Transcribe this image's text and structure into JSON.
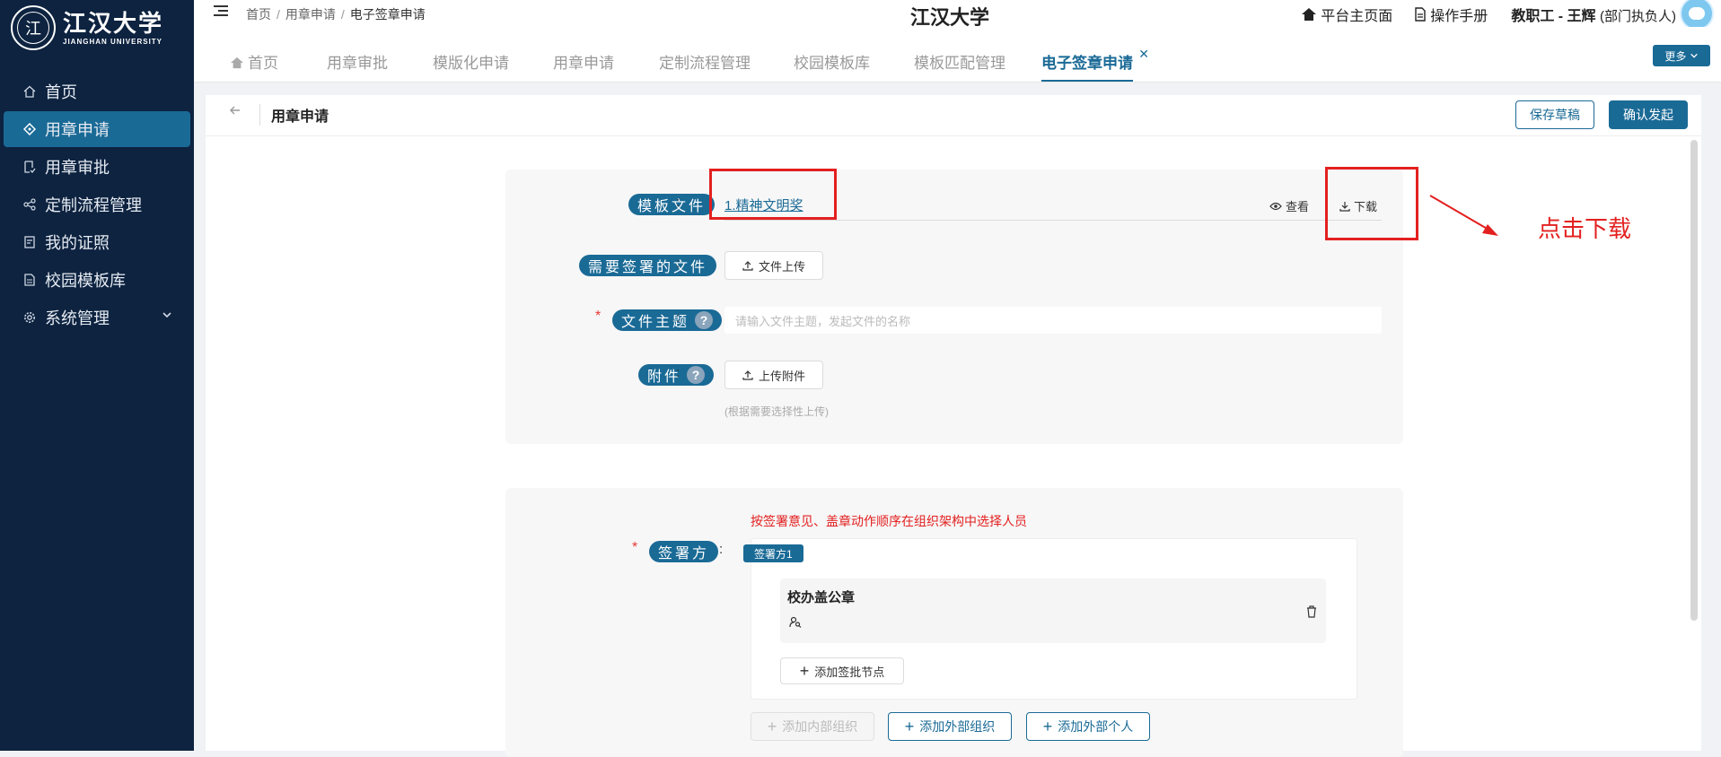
{
  "logo": {
    "seal_char": "江",
    "name_cn": "江汉大学",
    "name_en": "JIANGHAN UNIVERSITY"
  },
  "sidebar": {
    "items": [
      {
        "label": "首页",
        "icon": "home-icon"
      },
      {
        "label": "用章申请",
        "icon": "diamond-icon",
        "active": true
      },
      {
        "label": "用章审批",
        "icon": "document-check-icon"
      },
      {
        "label": "定制流程管理",
        "icon": "share-nodes-icon"
      },
      {
        "label": "我的证照",
        "icon": "certificate-icon"
      },
      {
        "label": "校园模板库",
        "icon": "file-template-icon"
      },
      {
        "label": "系统管理",
        "icon": "gear-icon",
        "expandable": true
      }
    ]
  },
  "header": {
    "breadcrumb": [
      "首页",
      "用章申请",
      "电子签章申请"
    ],
    "title": "江汉大学",
    "links": {
      "home": "平台主页面",
      "manual": "操作手册"
    },
    "user": {
      "name": "教职工 - 王辉",
      "role": "(部门执负人)"
    }
  },
  "tabs": {
    "items": [
      "首页",
      "用章审批",
      "模版化申请",
      "用章申请",
      "定制流程管理",
      "校园模板库",
      "模板匹配管理",
      "电子签章申请"
    ],
    "active_index": 7,
    "close_glyph": "✕",
    "more_label": "更多"
  },
  "page": {
    "title": "用章申请",
    "save_draft": "保存草稿",
    "confirm_submit": "确认发起"
  },
  "form": {
    "template_file_label": "模板文件",
    "template_file_name": "1.精神文明奖",
    "view_label": "查看",
    "download_label": "下载",
    "sign_file_label": "需要签署的文件",
    "upload_file_button": "文件上传",
    "subject_label": "文件主题",
    "subject_placeholder": "请输入文件主题，发起文件的名称",
    "attachment_label": "附件",
    "upload_attachment_button": "上传附件",
    "attachment_hint": "(根据需要选择性上传)",
    "colon": ":",
    "required_mark": "*",
    "help_mark": "?"
  },
  "annotation": {
    "text": "点击下载",
    "color": "#e32020"
  },
  "signers": {
    "notice": "按签署意见、盖章动作顺序在组织架构中选择人员",
    "label": "签署方",
    "tag": "签署方1",
    "node_title": "校办盖公章",
    "add_node": "添加签批节点",
    "add_internal_org": "添加内部组织",
    "add_external_org": "添加外部组织",
    "add_external_person": "添加外部个人"
  },
  "colors": {
    "sidebar_bg": "#0d2340",
    "accent": "#1a6a96",
    "annotation_red": "#e32020"
  }
}
